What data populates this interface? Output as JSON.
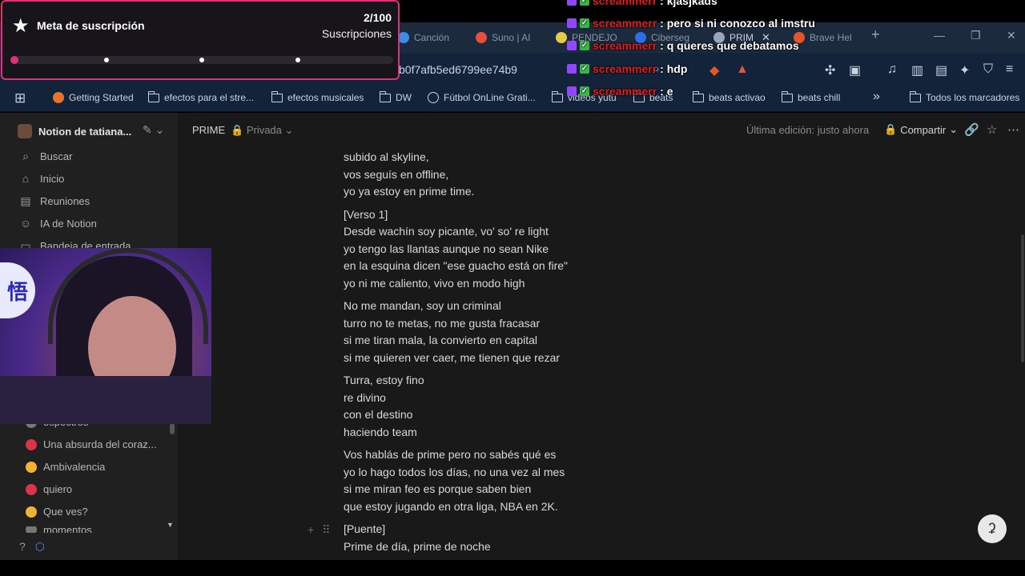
{
  "browser": {
    "tabs": [
      {
        "label": "Canción",
        "color": "#3a8ee6"
      },
      {
        "label": "Suno | AI",
        "color": "#e94e3c"
      },
      {
        "label": "PENDEJO",
        "color": "#e6c84a"
      },
      {
        "label": "Ciberseg",
        "color": "#2a6ee8"
      },
      {
        "label": "PRIM",
        "color": "#9aa6b8"
      },
      {
        "label": "Brave Hel",
        "color": "#e8532b"
      }
    ],
    "tab_close": "✕",
    "new_tab": "+",
    "url": "b0f7afb5ed6799ee74b9",
    "bookmarks": [
      "Getting Started",
      "efectos para el stre...",
      "efectos musicales",
      "DW",
      "Fútbol OnLine Grati...",
      "videos yutu",
      "beats",
      "beats activao",
      "beats chill"
    ],
    "bookmarks_more": "»",
    "all_bookmarks": "Todos los marcadores"
  },
  "sidebar": {
    "workspace": "Notion de tatiana...",
    "nav": [
      {
        "label": "Buscar",
        "icon": "search-icon"
      },
      {
        "label": "Inicio",
        "icon": "home-icon"
      },
      {
        "label": "Reuniones",
        "icon": "meetings-icon"
      },
      {
        "label": "IA de Notion",
        "icon": "ai-icon"
      },
      {
        "label": "Bandeja de entrada",
        "icon": "inbox-icon"
      }
    ],
    "pages": [
      {
        "label": "espectros",
        "color": "#777777"
      },
      {
        "label": "Una absurda del coraz...",
        "color": "#d9344a"
      },
      {
        "label": "Ambivalencia",
        "color": "#f2b234"
      },
      {
        "label": "quiero",
        "color": "#d9344a"
      },
      {
        "label": "Que ves?",
        "color": "#f2b234"
      },
      {
        "label": "momentos",
        "color": "#777777"
      }
    ]
  },
  "page": {
    "breadcrumb": "PRIME",
    "privacy": "Privada",
    "last_edit": "Última edición: justo ahora",
    "share": "Compartir",
    "paragraphs": [
      [
        "subido al skyline,",
        "vos seguís en offline,",
        "yo ya estoy en prime time."
      ],
      [
        "[Verso 1]",
        "Desde wachín soy picante, vo' so' re light",
        "yo tengo las llantas aunque no sean Nike",
        "en la esquina dicen \"ese guacho está on fire\"",
        "yo ni me caliento, vivo en modo high"
      ],
      [
        "No me mandan, soy un criminal",
        "turro no te metas, no me gusta fracasar",
        "si me tiran mala, la convierto en capital",
        "si me quieren ver caer, me tienen que rezar"
      ],
      [
        "Turra, estoy fino",
        "re divino",
        "con el destino",
        "haciendo team"
      ],
      [
        "Vos hablás de prime pero no sabés qué es",
        "yo lo hago todos los días, no una vez al mes",
        "si me miran feo es porque saben bien",
        "que estoy jugando en otra liga, NBA en 2K."
      ],
      [
        "[Puente]",
        "Prime de día, prime de noche"
      ]
    ]
  },
  "overlay": {
    "goal_title": "Meta de suscripción",
    "goal_count": "2/100",
    "goal_unit": "Suscripciones",
    "goal_progress": 0.02,
    "goal_milestones": [
      0.25,
      0.5,
      0.75
    ],
    "accent": "#e0307a",
    "chat": [
      {
        "user": "screammerr",
        "text": ": kjasjkads"
      },
      {
        "user": "screammerr",
        "text": ": pero si ni conozco al imstru"
      },
      {
        "user": "screammerr",
        "text": ": q queres que debatamos"
      },
      {
        "user": "screammerr",
        "text": ": hdp"
      },
      {
        "user": "screammerr",
        "text": ": e"
      }
    ],
    "webcam_logo": "悟"
  }
}
